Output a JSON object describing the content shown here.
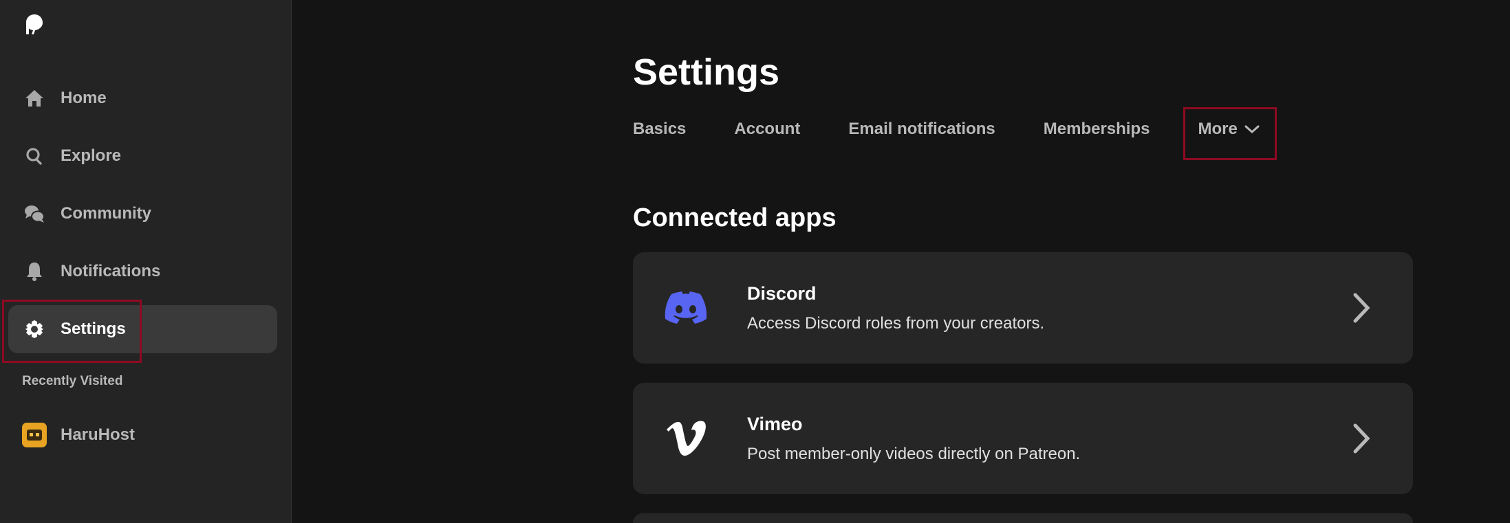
{
  "sidebar": {
    "logo_icon": "patreon-logo-icon",
    "items": [
      {
        "label": "Home",
        "icon": "home-icon"
      },
      {
        "label": "Explore",
        "icon": "search-icon"
      },
      {
        "label": "Community",
        "icon": "chat-bubbles-icon"
      },
      {
        "label": "Notifications",
        "icon": "bell-icon"
      },
      {
        "label": "Settings",
        "icon": "gear-icon",
        "active": true
      }
    ],
    "recently_visited_label": "Recently Visited",
    "recent": [
      {
        "label": "HaruHost",
        "icon": "creator-avatar"
      }
    ]
  },
  "main": {
    "title": "Settings",
    "tabs": [
      {
        "label": "Basics"
      },
      {
        "label": "Account"
      },
      {
        "label": "Email notifications"
      },
      {
        "label": "Memberships"
      },
      {
        "label": "More",
        "icon": "chevron-down-icon"
      }
    ],
    "section_title": "Connected apps",
    "apps": [
      {
        "name": "Discord",
        "description": "Access Discord roles from your creators.",
        "icon": "discord-icon",
        "color": "#5865F2"
      },
      {
        "name": "Vimeo",
        "description": "Post member-only videos directly on Patreon.",
        "icon": "vimeo-icon",
        "color": "#ffffff"
      }
    ]
  },
  "colors": {
    "background": "#141414",
    "sidebar": "#242424",
    "card": "#262626",
    "highlight": "#8e0a22",
    "discord": "#5865F2"
  }
}
